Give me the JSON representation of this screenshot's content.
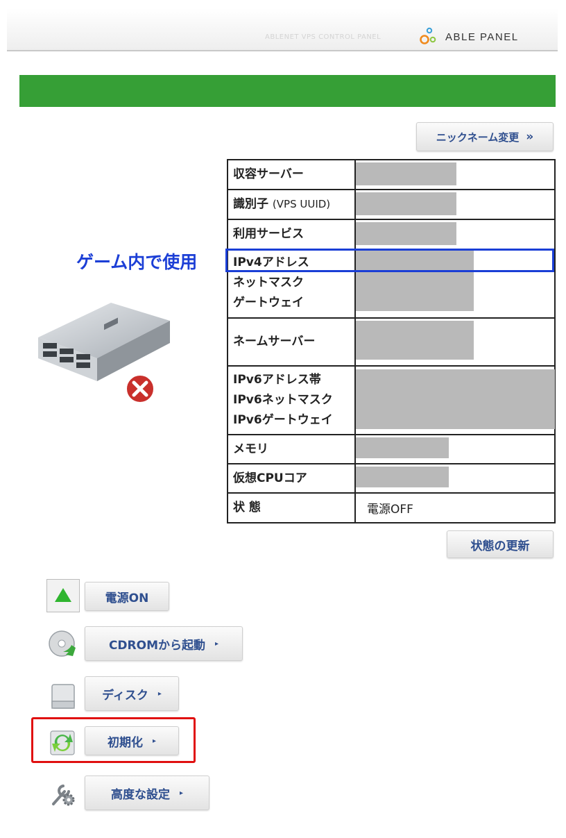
{
  "header": {
    "subtitle": "ABLENET VPS CONTROL PANEL",
    "brand": "ABLE PANEL"
  },
  "colors": {
    "accent_green": "#369f36",
    "link_blue": "#2f4f8f",
    "annotation_blue": "#1a3ed6",
    "annotation_red": "#e01010"
  },
  "nickname_button": {
    "label": "ニックネーム変更",
    "icon": "double-chevron-right-icon",
    "arrow": "»"
  },
  "info_table": {
    "rows": [
      {
        "label": "収容サーバー"
      },
      {
        "label": "識別子",
        "label_note": "(VPS UUID)"
      },
      {
        "label": "利用サービス"
      },
      {
        "label_lines": [
          "IPv4アドレス",
          "ネットマスク",
          "ゲートウェイ"
        ]
      },
      {
        "label": "ネームサーバー"
      },
      {
        "label_lines": [
          "IPv6アドレス帯",
          "IPv6ネットマスク",
          "IPv6ゲートウェイ"
        ]
      },
      {
        "label": "メモリ"
      },
      {
        "label": "仮想CPUコア"
      },
      {
        "label": "状 態",
        "value": "電源OFF"
      }
    ]
  },
  "status_refresh_button": {
    "label": "状態の更新"
  },
  "annotation": {
    "text": "ゲーム内で使用"
  },
  "server_icon": {
    "name": "server-icon",
    "badge": "error-x-icon"
  },
  "actions": [
    {
      "label": "電源ON",
      "icon": "power-on-triangle-icon"
    },
    {
      "label": "CDROMから起動",
      "icon": "cdrom-boot-icon",
      "arrow": "▸"
    },
    {
      "label": "ディスク",
      "icon": "disk-icon",
      "arrow": "▸"
    },
    {
      "label": "初期化",
      "icon": "reinitialize-icon",
      "arrow": "▸"
    },
    {
      "label": "高度な設定",
      "icon": "settings-wrench-gear-icon",
      "arrow": "▸"
    }
  ]
}
